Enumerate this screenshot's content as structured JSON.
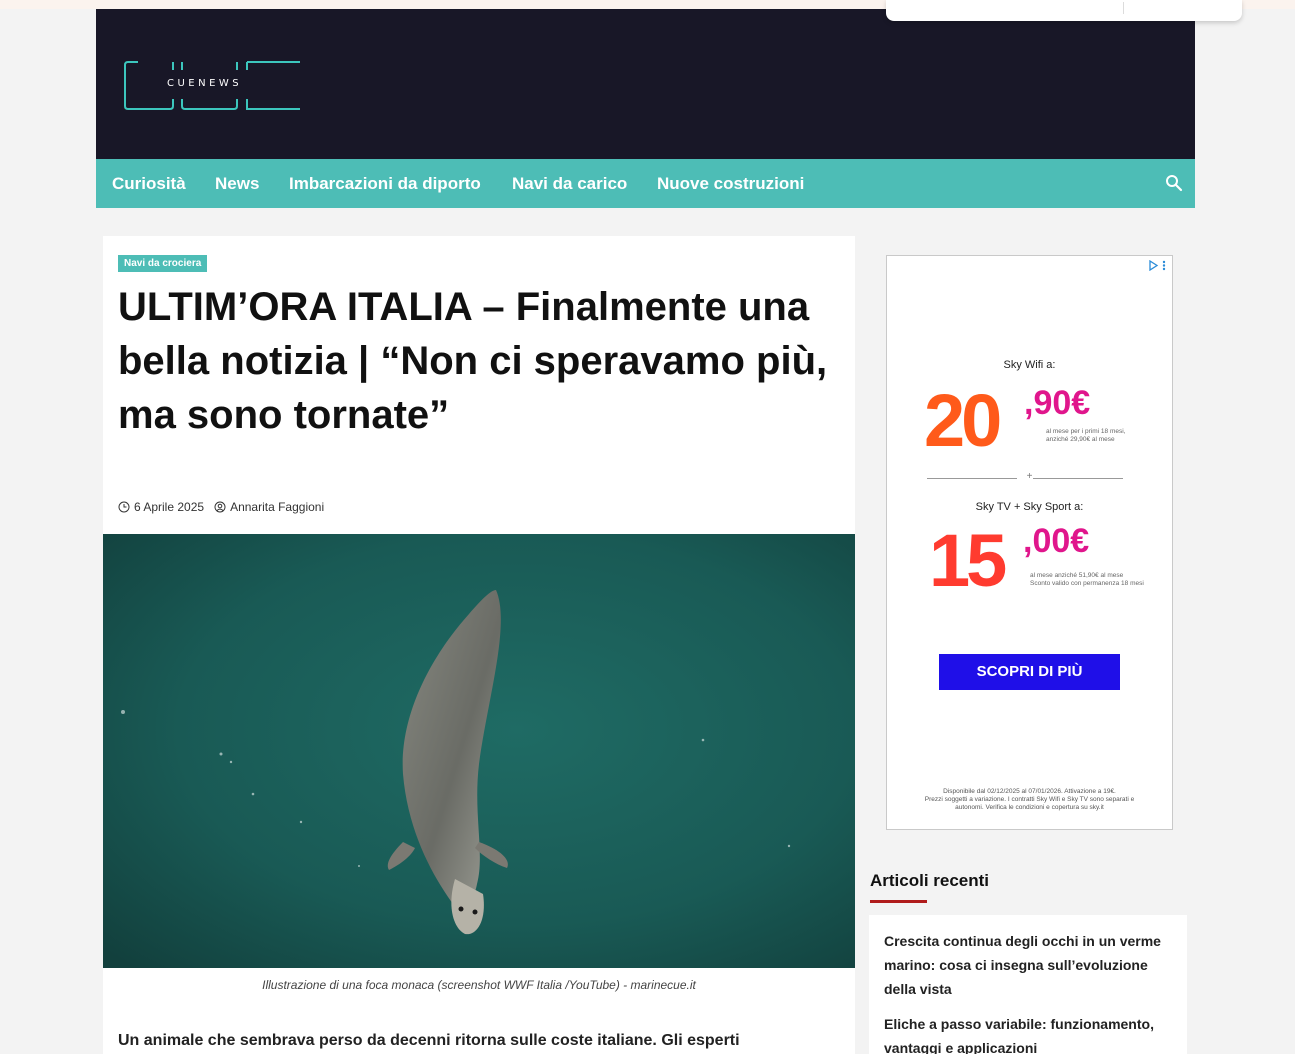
{
  "site": {
    "logo_text": "CUENEWS"
  },
  "nav": {
    "items": [
      "Curiosità",
      "News",
      "Imbarcazioni da diporto",
      "Navi da carico",
      "Nuove costruzioni"
    ],
    "search_icon": "search-icon"
  },
  "article": {
    "category": "Navi da crociera",
    "title": "ULTIM’ORA ITALIA – Finalmente una bella notizia | “Non ci speravamo più, ma sono tornate”",
    "date": "6 Aprile 2025",
    "author": "Annarita Faggioni",
    "image_caption": "Illustrazione di una foca monaca (screenshot WWF Italia /YouTube) - marinecue.it",
    "intro": "Un animale che sembrava perso da decenni ritorna sulle coste italiane. Gli esperti"
  },
  "ad": {
    "offer1_label": "Sky Wifi a:",
    "offer1_int": "20",
    "offer1_dec": ",90€",
    "offer1_note1": "al mese per i primi 18 mesi,",
    "offer1_note2": "anziché 29,90€ al mese",
    "plus": "+",
    "offer2_label": "Sky TV + Sky Sport a:",
    "offer2_int": "15",
    "offer2_dec": ",00€",
    "offer2_note1": "al mese anziché 51,90€ al mese",
    "offer2_note2": "Sconto valido con permanenza 18 mesi",
    "cta": "SCOPRI DI PIÙ",
    "legal1": "Disponibile dal 02/12/2025 al 07/01/2026. Attivazione a 19€.",
    "legal2": "Prezzi soggetti a variazione. I contratti Sky Wifi e Sky TV sono separati e",
    "legal3": "autonomi. Verifica le condizioni e copertura su sky.it"
  },
  "sidebar": {
    "recent_title": "Articoli recenti",
    "recent_items": [
      "Crescita continua degli occhi in un verme marino: cosa ci insegna sull’evoluzione della vista",
      "Eliche a passo variabile: funzionamento, vantaggi e applicazioni"
    ]
  },
  "colors": {
    "header_bg": "#181727",
    "nav_bg": "#4dbdb6",
    "accent_teal": "#4dbdb6",
    "cta_blue": "#1f0fe8",
    "recent_underline": "#b01b1b"
  }
}
